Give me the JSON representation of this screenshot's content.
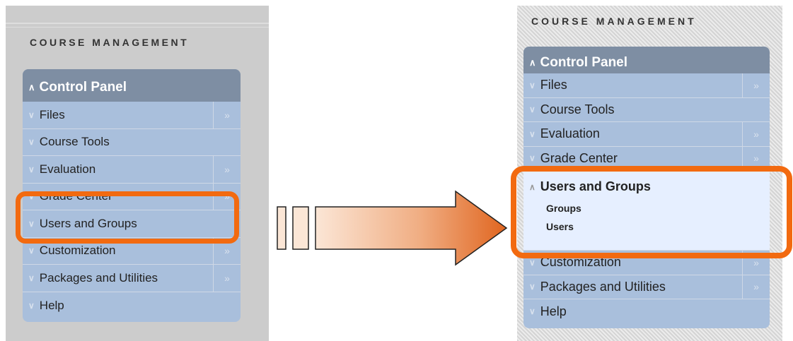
{
  "left": {
    "section_title": "COURSE MANAGEMENT",
    "header": "Control Panel",
    "items": [
      {
        "label": "Files",
        "has_submenu": true
      },
      {
        "label": "Course Tools",
        "has_submenu": false
      },
      {
        "label": "Evaluation",
        "has_submenu": true
      },
      {
        "label": "Grade Center",
        "has_submenu": true
      },
      {
        "label": "Users and Groups",
        "has_submenu": false
      },
      {
        "label": "Customization",
        "has_submenu": true
      },
      {
        "label": "Packages and Utilities",
        "has_submenu": true
      },
      {
        "label": "Help",
        "has_submenu": false
      }
    ]
  },
  "right": {
    "section_title": "COURSE MANAGEMENT",
    "header": "Control Panel",
    "items_before": [
      {
        "label": "Files"
      },
      {
        "label": "Course Tools"
      },
      {
        "label": "Evaluation"
      },
      {
        "label": "Grade Center"
      }
    ],
    "expanded": {
      "label": "Users and Groups",
      "subitems": [
        "Groups",
        "Users"
      ]
    },
    "items_after": [
      {
        "label": "Customization"
      },
      {
        "label": "Packages and Utilities"
      },
      {
        "label": "Help"
      }
    ]
  },
  "glyphs": {
    "down": "≫",
    "right": "»",
    "up": "≪"
  },
  "colors": {
    "highlight": "#f26a10",
    "menu_bg": "#a9bfdc",
    "menu_header": "#7e8ea3",
    "expanded_bg": "#e6efff"
  }
}
